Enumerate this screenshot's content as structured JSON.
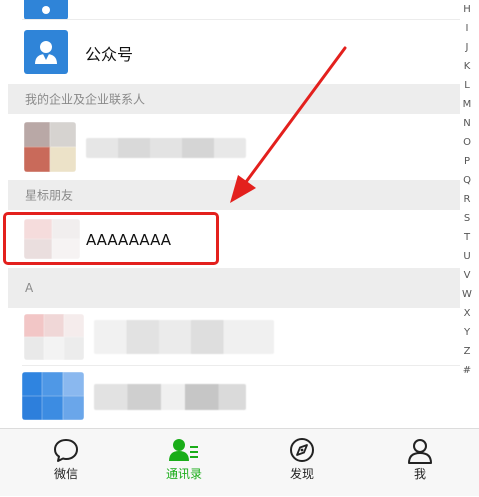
{
  "contacts": {
    "official_accounts_label": "公众号",
    "sections": {
      "enterprise": "我的企业及企业联系人",
      "starred": "星标朋友",
      "a": "A"
    },
    "starred_contact_name": "AAAAAAAA"
  },
  "index_letters": [
    "H",
    "I",
    "J",
    "K",
    "L",
    "M",
    "N",
    "O",
    "P",
    "Q",
    "R",
    "S",
    "T",
    "U",
    "V",
    "W",
    "X",
    "Y",
    "Z",
    "#"
  ],
  "tabbar": {
    "chats": "微信",
    "contacts": "通讯录",
    "discover": "发现",
    "me": "我"
  },
  "colors": {
    "accent_green": "#1aad19",
    "annotation_red": "#e3201d",
    "icon_blue": "#2f84d8"
  }
}
